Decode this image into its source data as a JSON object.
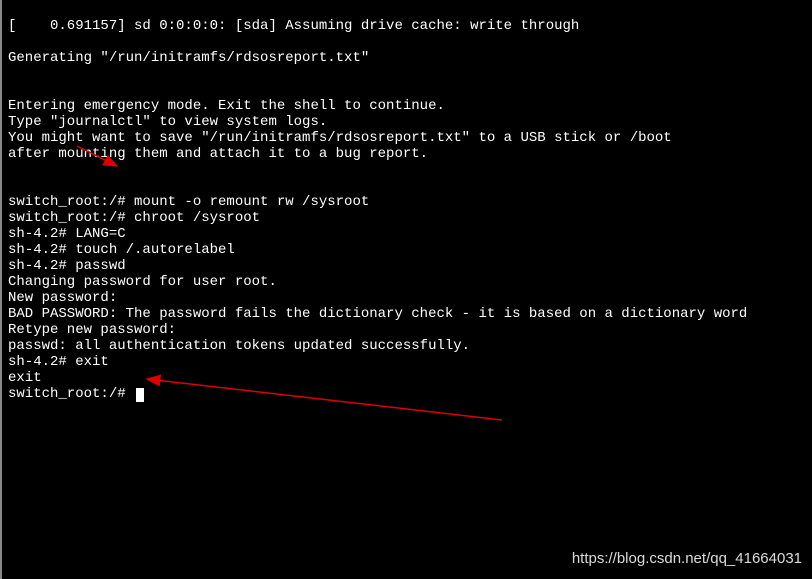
{
  "terminal": {
    "lines": [
      "[    0.691157] sd 0:0:0:0: [sda] Assuming drive cache: write through",
      "",
      "Generating \"/run/initramfs/rdsosreport.txt\"",
      "",
      "",
      "Entering emergency mode. Exit the shell to continue.",
      "Type \"journalctl\" to view system logs.",
      "You might want to save \"/run/initramfs/rdsosreport.txt\" to a USB stick or /boot",
      "after mounting them and attach it to a bug report.",
      "",
      "",
      "switch_root:/# mount -o remount rw /sysroot",
      "switch_root:/# chroot /sysroot",
      "sh-4.2# LANG=C",
      "sh-4.2# touch /.autorelabel",
      "sh-4.2# passwd",
      "Changing password for user root.",
      "New password:",
      "BAD PASSWORD: The password fails the dictionary check - it is based on a dictionary word",
      "Retype new password:",
      "passwd: all authentication tokens updated successfully.",
      "sh-4.2# exit",
      "exit",
      "switch_root:/# "
    ]
  },
  "watermark": "https://blog.csdn.net/qq_41664031",
  "arrows": {
    "arrow1": {
      "color": "#dd0000"
    },
    "arrow2": {
      "color": "#dd0000"
    }
  }
}
